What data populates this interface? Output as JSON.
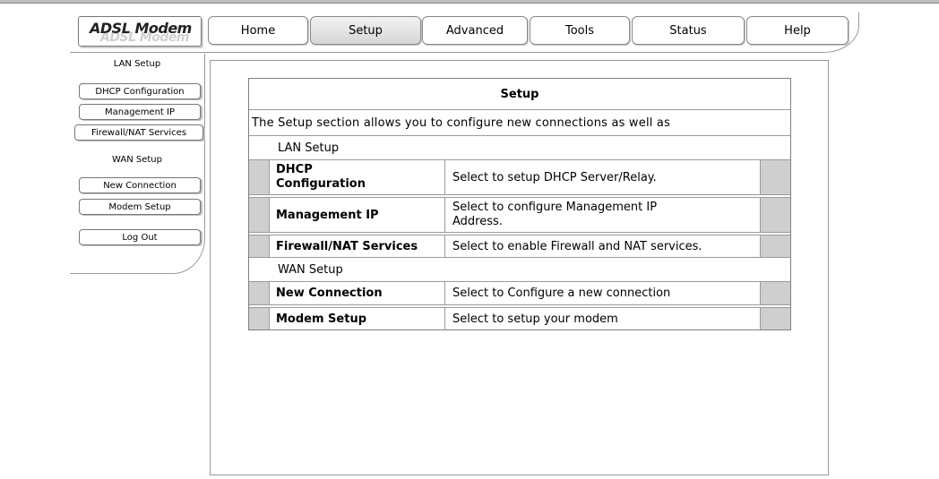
{
  "app": {
    "logo": "ADSL Modem"
  },
  "nav": {
    "tabs": [
      {
        "label": "Home"
      },
      {
        "label": "Setup"
      },
      {
        "label": "Advanced"
      },
      {
        "label": "Tools"
      },
      {
        "label": "Status"
      },
      {
        "label": "Help"
      }
    ],
    "active": "Setup"
  },
  "sidebar": {
    "lan_label": "LAN Setup",
    "items": [
      {
        "label": "DHCP Configuration"
      },
      {
        "label": "Management IP"
      },
      {
        "label": "Firewall/NAT Services"
      },
      {
        "label": "WAN Setup"
      },
      {
        "label": "New Connection"
      },
      {
        "label": "Modem Setup"
      },
      {
        "label": "Log Out"
      }
    ]
  },
  "main": {
    "title": "Setup",
    "description": "The Setup section allows you to configure new connections as well as",
    "sections": [
      {
        "label": "LAN Setup",
        "rows": [
          {
            "name": "DHCP Configuration",
            "desc": "Select to setup DHCP Server/Relay."
          },
          {
            "name": "Management IP",
            "desc": "Select to configure Management IP Address."
          },
          {
            "name": "Firewall/NAT Services",
            "desc": "Select to enable Firewall and NAT services."
          }
        ]
      },
      {
        "label": "WAN Setup",
        "rows": [
          {
            "name": "New Connection",
            "desc": "Select to Configure a new connection"
          },
          {
            "name": "Modem Setup",
            "desc": "Select to setup your modem"
          }
        ]
      }
    ]
  },
  "colors": {
    "border": "#9a9a9a",
    "gray_cell": "#cfcfcf",
    "active_tab": "#d6d6d6"
  }
}
